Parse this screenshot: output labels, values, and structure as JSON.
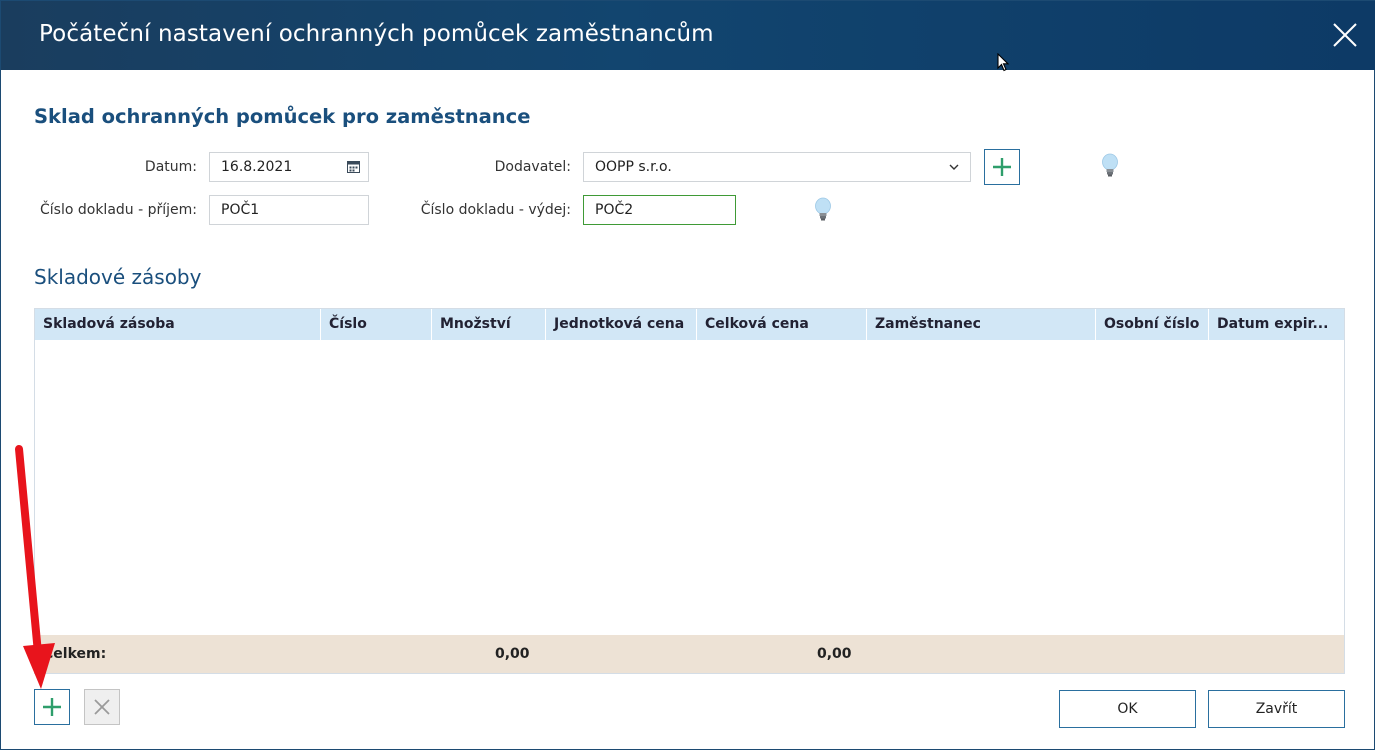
{
  "window": {
    "title": "Počáteční nastavení ochranných pomůcek zaměstnancům"
  },
  "form": {
    "heading": "Sklad ochranných pomůcek pro zaměstnance",
    "datum_label": "Datum:",
    "datum_value": "16.8.2021",
    "dodavatel_label": "Dodavatel:",
    "dodavatel_value": "OOPP s.r.o.",
    "prijem_label": "Číslo dokladu - příjem:",
    "prijem_value": "POČ1",
    "vydej_label": "Číslo dokladu - výdej:",
    "vydej_value": "POČ2"
  },
  "grid": {
    "section_title": "Skladové zásoby",
    "columns": [
      "Skladová zásoba",
      "Číslo",
      "Množství",
      "Jednotková cena",
      "Celková cena",
      "Zaměstnanec",
      "Osobní číslo",
      "Datum expir..."
    ],
    "footer": {
      "label": "Celkem:",
      "mnozstvi": "0,00",
      "celkova_cena": "0,00"
    }
  },
  "buttons": {
    "ok": "OK",
    "close": "Zavřít"
  },
  "colors": {
    "titlebar": "#12456f",
    "accent": "#1a4f7d",
    "plus_green": "#2e9e6b",
    "grid_header": "#d2e7f6",
    "grid_footer": "#ede2d5",
    "annotation_arrow": "#e8141c"
  },
  "icons": {
    "close": "close-icon",
    "calendar": "calendar-icon",
    "dropdown": "chevron-down-icon",
    "add": "plus-icon",
    "remove": "x-icon",
    "hint": "lightbulb-icon",
    "pointer": "mouse-cursor-icon",
    "annotation": "red-arrow-icon"
  }
}
